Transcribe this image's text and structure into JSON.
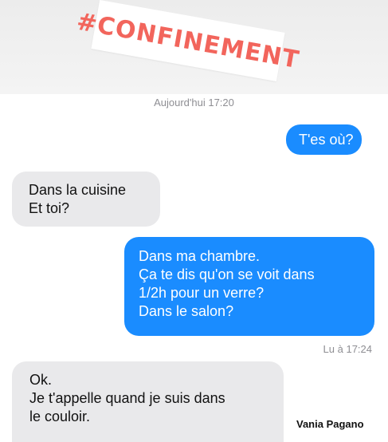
{
  "header": {
    "hashtag": "#CONFINEMENT"
  },
  "conversation": {
    "timestamp": "Aujourd'hui 17:20",
    "messages": [
      {
        "direction": "outgoing",
        "lines": [
          "T'es où?"
        ]
      },
      {
        "direction": "incoming",
        "lines": [
          "Dans la cuisine",
          "Et toi?"
        ]
      },
      {
        "direction": "outgoing",
        "lines": [
          "Dans ma chambre.",
          "Ça te dis qu'on se voit dans",
          "1/2h pour un verre?",
          "Dans le salon?"
        ]
      },
      {
        "direction": "incoming",
        "lines": [
          "Ok.",
          "Je t'appelle quand je suis dans",
          "le couloir."
        ]
      }
    ],
    "read_receipt": "Lu à 17:24"
  },
  "credit": "Vania Pagano",
  "colors": {
    "outgoing_bubble": "#1a8cff",
    "incoming_bubble": "#e9e9eb",
    "hashtag": "#f2655c",
    "meta_text": "#8e8e93"
  }
}
